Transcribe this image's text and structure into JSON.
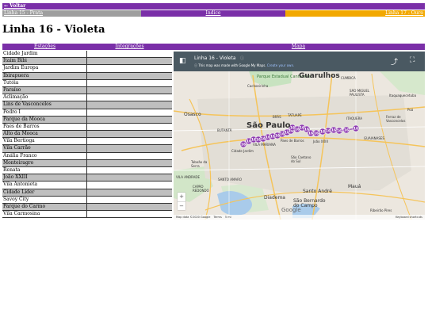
{
  "nav": {
    "back": "← Voltar",
    "prev": "Linha 15 - Prata",
    "index": "Índice",
    "next": "Linha 17 - Ouro"
  },
  "page_title": "Linha 16 - Violeta",
  "table": {
    "headers": [
      "Estações",
      "Integrações",
      "Mapa"
    ],
    "stations": [
      "Cidade Jardim",
      "Itaim Bibi",
      "Jardim Europa",
      "Ibirapuera",
      "Tutóia",
      "Paraíso",
      "Aclimação",
      "Lins de Vasconcelos",
      "Pedro I",
      "Parque da Mooca",
      "Paes de Barros",
      "Alto da Mooca",
      "Vila Bertioga",
      "Vila Carrão",
      "Anália Franco",
      "Monteiragro",
      "Renata",
      "João XXIII",
      "Vila Antonieta",
      "Cidade Líder",
      "Savoy City",
      "Parque do Carmo",
      "Vila Carmosina"
    ]
  },
  "map": {
    "title": "Linha 16 - Violeta",
    "subtitle": "This map was made with Google My Maps.",
    "create_link": "Create your own.",
    "footer_data": "Map data ©2020 Google",
    "footer_terms": "Terms",
    "footer_scale": "5 mi",
    "footer_shortcuts": "Keyboard shortcuts",
    "zoom_in": "+",
    "zoom_out": "−",
    "google_logo": "Google",
    "places": {
      "cantareira": "Parque Estadual Cantareira",
      "guarulhos": "Guarulhos",
      "cumbica": "CUMBICA",
      "cachoeirinha": "Cachoeirinha",
      "sao_miguel": "SÃO MIGUEL PAULISTA",
      "itaquaquecetuba": "Itaquaquecetuba",
      "osasco": "Osasco",
      "bras": "BRÁS",
      "tatuape": "TATUAPÉ",
      "itaquera": "ITAQUERA",
      "ferraz": "Ferraz de Vasconcelos",
      "poa": "Poá",
      "butanta": "BUTANTÃ",
      "sao_paulo": "São Paulo",
      "paes": "Paes de Barros",
      "joao": "João XXIII",
      "guaianases": "GUAIANASES",
      "vila_mariana": "VILA MARIANA",
      "cidade_jardim": "Cidade Jardim",
      "sao_caetano": "São Caetano do Sul",
      "taboao": "Taboão da Serra",
      "vila_andrade": "VILA ANDRADE",
      "santo_amaro": "SANTO AMARO",
      "capao": "CAPÃO REDONDO",
      "santo_andre": "Santo André",
      "maua": "Mauá",
      "diadema": "Diadema",
      "sbc": "São Bernardo do Campo",
      "riberao": "Ribeirão Pires"
    },
    "marker_label": "16"
  },
  "colors": {
    "purple": "#7a2fa8",
    "gray": "#9e9e9e",
    "orange": "#f2a800",
    "marker": "#8e3bb0"
  }
}
